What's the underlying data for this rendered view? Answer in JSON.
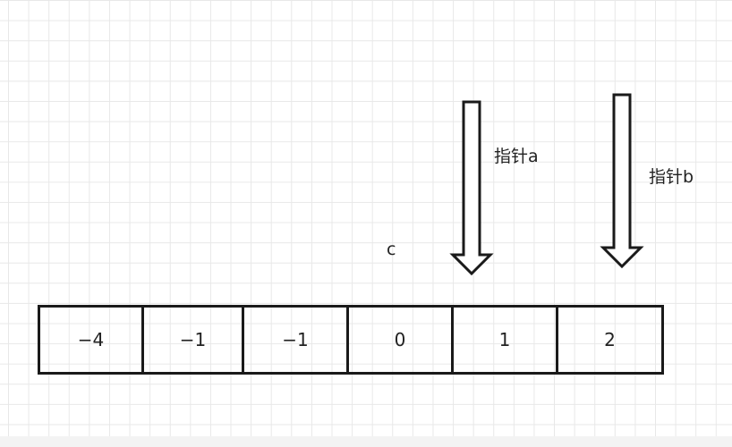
{
  "array": {
    "cells": [
      {
        "value": "−4"
      },
      {
        "value": "−1"
      },
      {
        "value": "−1"
      },
      {
        "value": "0"
      },
      {
        "value": "1"
      },
      {
        "value": "2"
      }
    ]
  },
  "labels": {
    "c": "c",
    "pointer_a": "指针a",
    "pointer_b": "指针b"
  },
  "colors": {
    "stroke": "#1a1a1a",
    "text": "#222222",
    "grid": "#e8e8e8",
    "background": "#ffffff"
  }
}
